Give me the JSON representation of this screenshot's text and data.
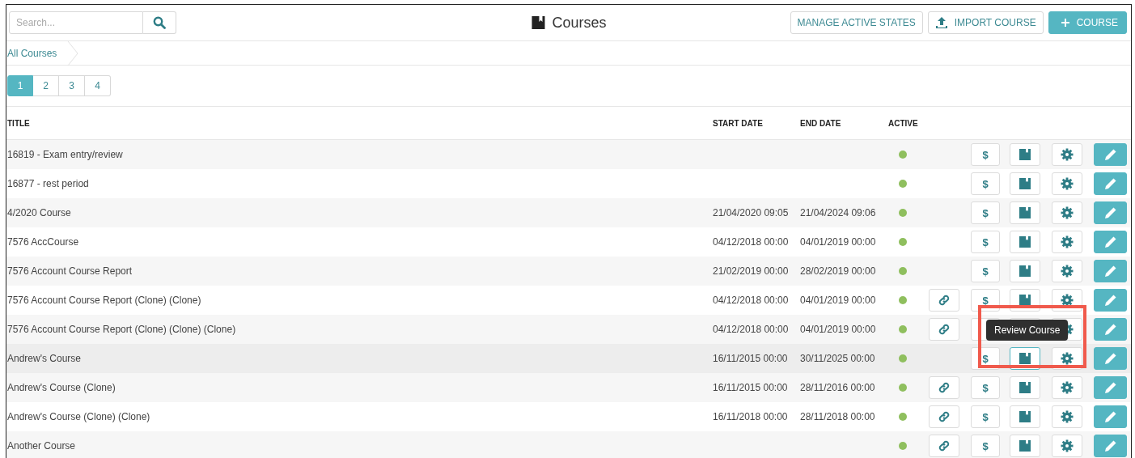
{
  "search": {
    "placeholder": "Search..."
  },
  "title": "Courses",
  "header_buttons": [
    {
      "label": "MANAGE ACTIVE STATES",
      "kind": "plain"
    },
    {
      "label": "IMPORT COURSE",
      "kind": "import"
    },
    {
      "label": "COURSE",
      "kind": "add"
    }
  ],
  "breadcrumb": [
    "All Courses"
  ],
  "pages": [
    {
      "label": "1",
      "selected": true
    },
    {
      "label": "2",
      "selected": false
    },
    {
      "label": "3",
      "selected": false
    },
    {
      "label": "4",
      "selected": false
    }
  ],
  "table": {
    "columns": [
      "TITLE",
      "START DATE",
      "END DATE",
      "ACTIVE"
    ],
    "rows": [
      {
        "title": "16819 - Exam entry/review",
        "active": true,
        "link": false,
        "price": "$",
        "hovered": false
      },
      {
        "title": "16877 - rest period",
        "active": true,
        "link": false,
        "price": "$",
        "hovered": false
      },
      {
        "title": "4/2020 Course",
        "start": "21/04/2020 09:05",
        "end": "21/04/2024 09:06",
        "active": true,
        "link": false,
        "price": "$",
        "hovered": false
      },
      {
        "title": "7576 AccCourse",
        "start": "04/12/2018 00:00",
        "end": "04/01/2019 00:00",
        "active": true,
        "link": false,
        "price": "$",
        "hovered": false
      },
      {
        "title": "7576 Account Course Report",
        "start": "21/02/2019 00:00",
        "end": "28/02/2019 00:00",
        "active": true,
        "link": false,
        "price": "$",
        "hovered": false
      },
      {
        "title": "7576 Account Course Report (Clone) (Clone)",
        "start": "04/12/2018 00:00",
        "end": "04/01/2019 00:00",
        "active": true,
        "link": true,
        "price": "$",
        "hovered": false
      },
      {
        "title": "7576 Account Course Report (Clone) (Clone) (Clone)",
        "start": "04/12/2018 00:00",
        "end": "04/01/2019 00:00",
        "active": true,
        "link": true,
        "hovered": false
      },
      {
        "title": "Andrew's Course",
        "start": "16/11/2015 00:00",
        "end": "30/11/2025 00:00",
        "active": true,
        "link": false,
        "price": "$",
        "hovered": true,
        "tooltip": "Review Course"
      },
      {
        "title": "Andrew's Course (Clone)",
        "start": "16/11/2015 00:00",
        "end": "28/11/2016 00:00",
        "active": true,
        "link": true,
        "price": "$",
        "hovered": false
      },
      {
        "title": "Andrew's Course (Clone) (Clone)",
        "start": "16/11/2018 00:00",
        "end": "28/11/2018 00:00",
        "active": true,
        "link": true,
        "price": "$",
        "hovered": false
      },
      {
        "title": "Another Course",
        "active": true,
        "link": true,
        "price": "$",
        "hovered": false
      }
    ]
  }
}
